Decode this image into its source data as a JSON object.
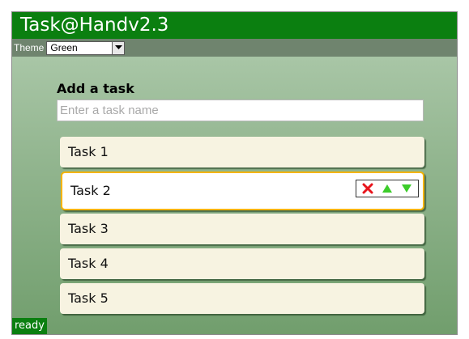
{
  "app": {
    "title": "Task@Handv2.3"
  },
  "toolbar": {
    "theme_label": "Theme",
    "theme_selected": "Green"
  },
  "add_task": {
    "heading": "Add a task",
    "input_value": "",
    "input_placeholder": "Enter a task name"
  },
  "tasks": [
    {
      "label": "Task 1",
      "selected": false
    },
    {
      "label": "Task 2",
      "selected": true
    },
    {
      "label": "Task 3",
      "selected": false
    },
    {
      "label": "Task 4",
      "selected": false
    },
    {
      "label": "Task 5",
      "selected": false
    }
  ],
  "task_controls": {
    "icons": [
      "delete-icon",
      "move-up-icon",
      "move-down-icon"
    ]
  },
  "status": {
    "text": "ready"
  },
  "colors": {
    "brand_green": "#0b7f10",
    "selected_border": "#f5b400",
    "task_background": "#f7f3e1",
    "delete_red": "#e8141c",
    "arrow_green": "#3ccc2a"
  }
}
